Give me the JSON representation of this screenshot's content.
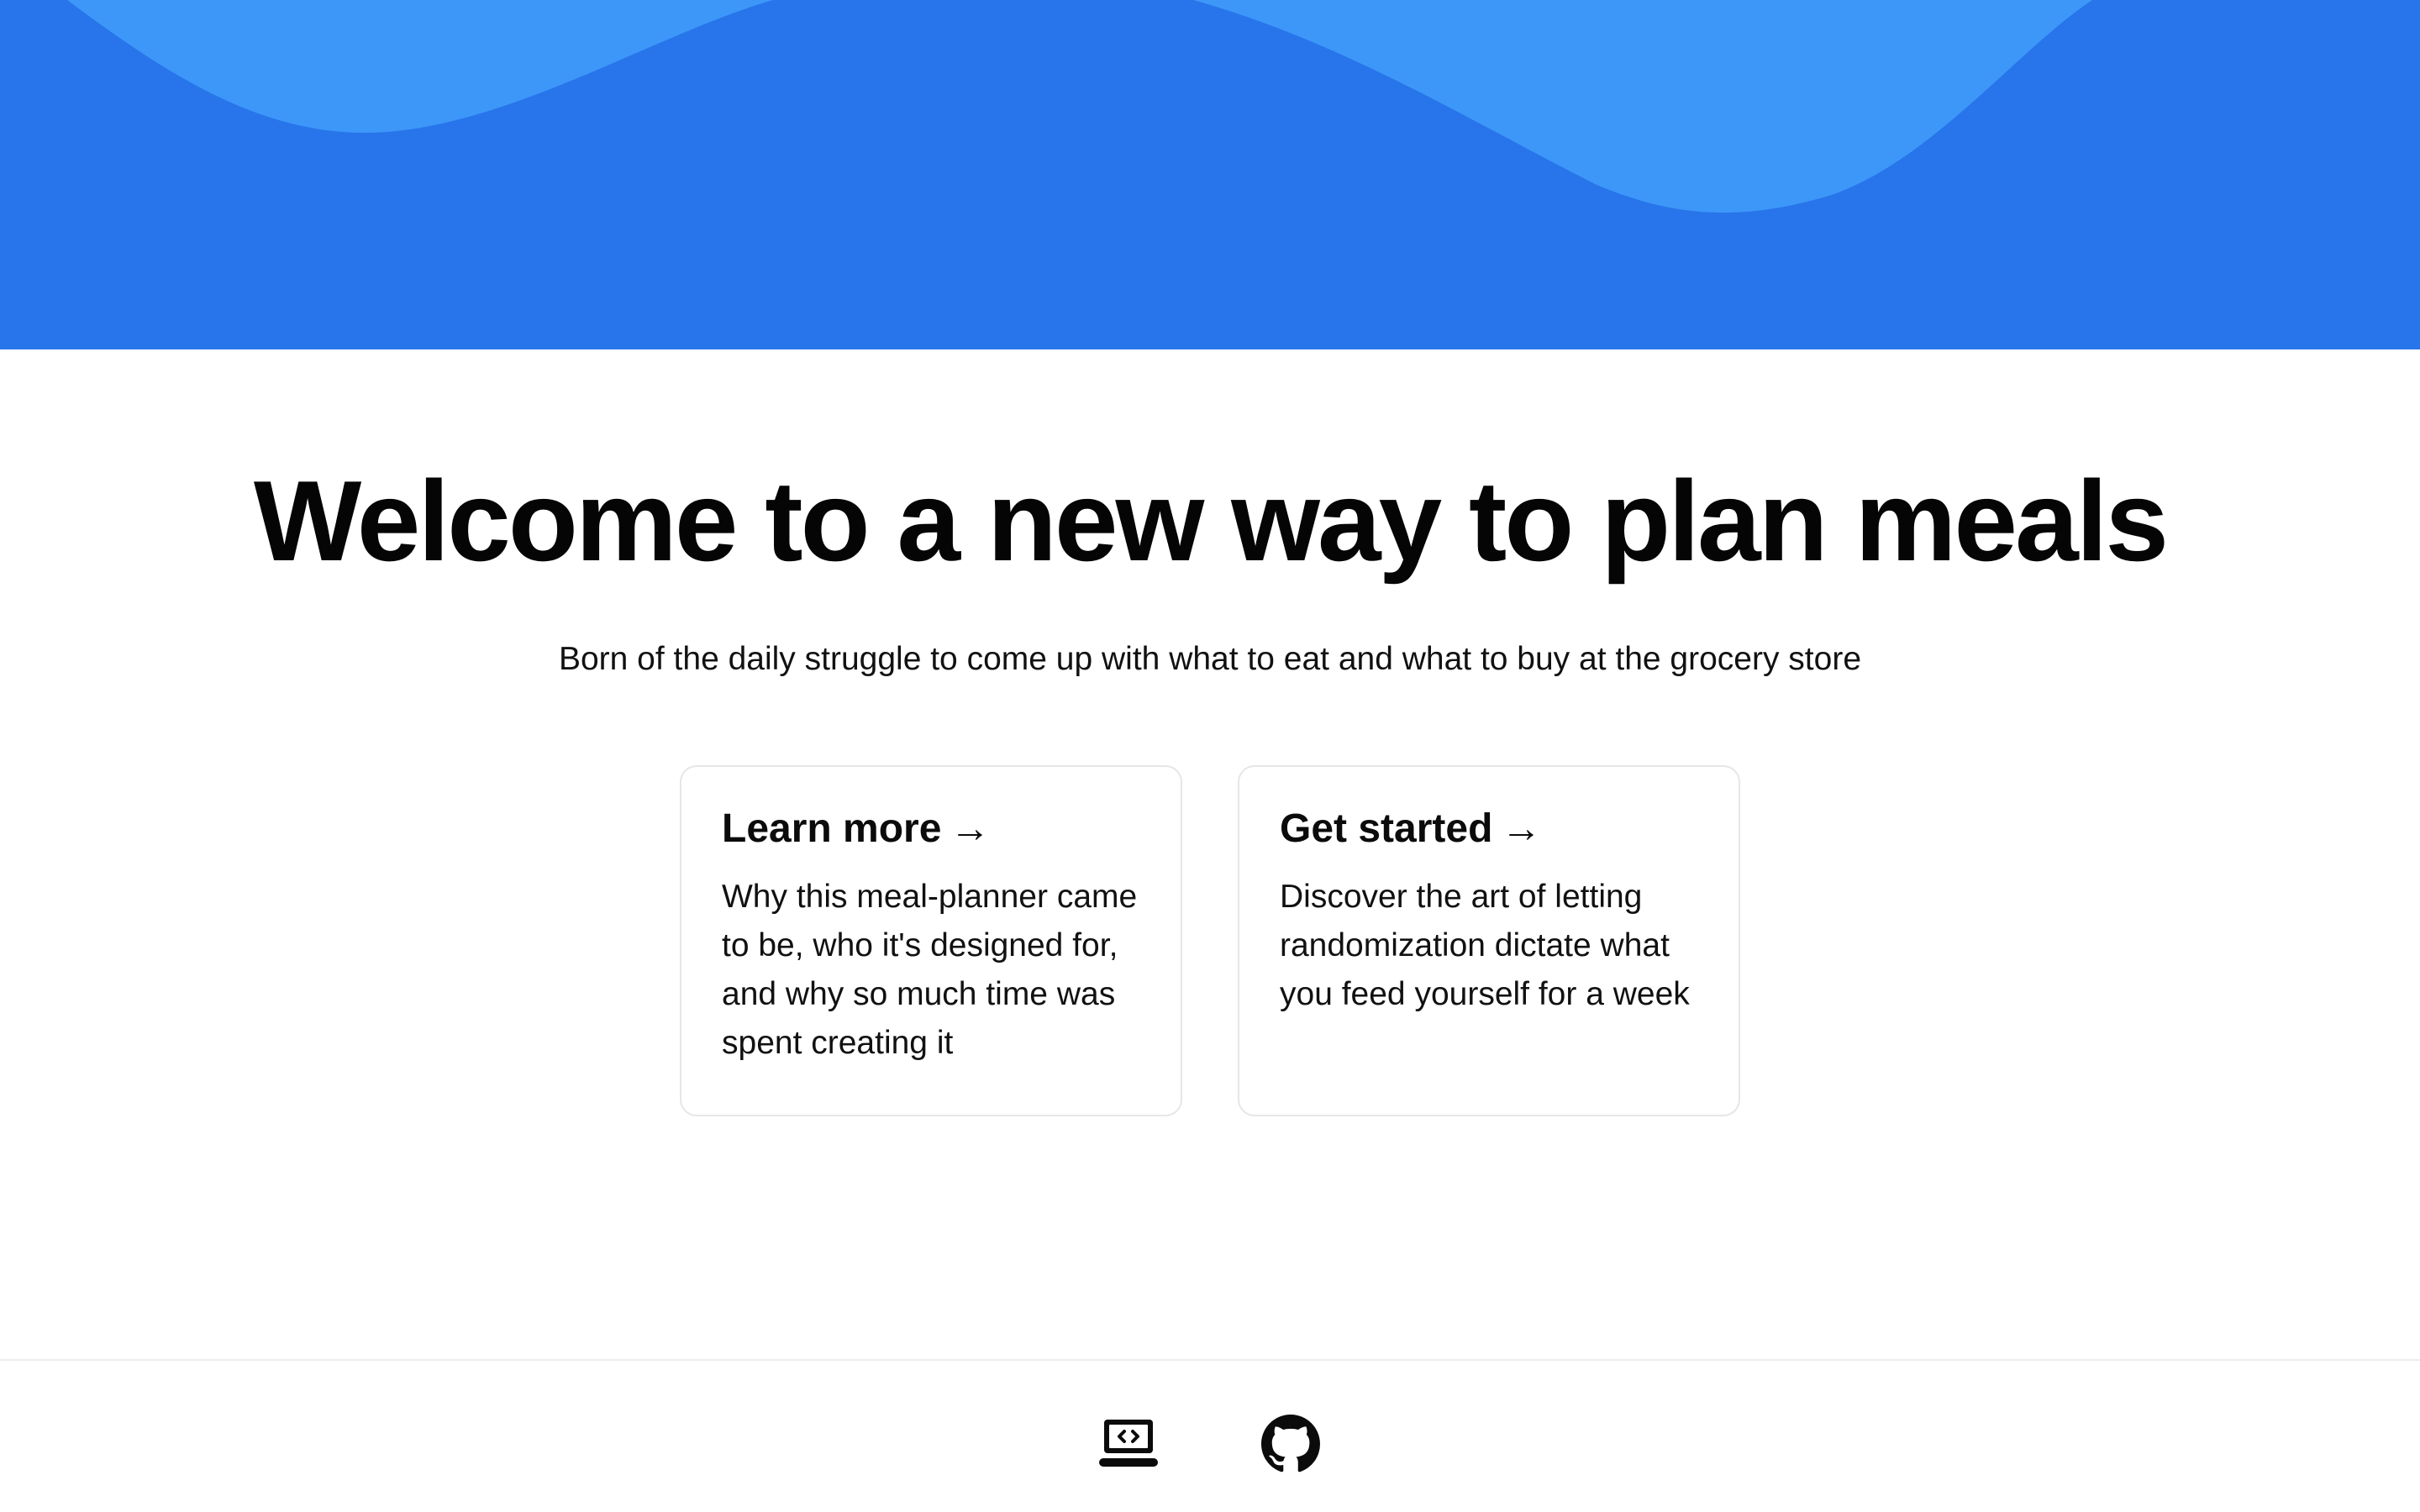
{
  "hero": {
    "background_color": "#2874ea",
    "wave_color": "#3d97f8"
  },
  "main": {
    "title": "Welcome to a new way to plan meals",
    "subtitle": "Born of the daily struggle to come up with what to eat and what to buy at the grocery store"
  },
  "cards": [
    {
      "title": "Learn more",
      "arrow": "→",
      "description": "Why this meal-planner came to be, who it's designed for, and why so much time was spent creating it"
    },
    {
      "title": "Get started",
      "arrow": "→",
      "description": "Discover the art of letting randomization dictate what you feed yourself for a week"
    }
  ],
  "footer": {
    "icons": [
      "laptop-code-icon",
      "github-icon"
    ]
  }
}
